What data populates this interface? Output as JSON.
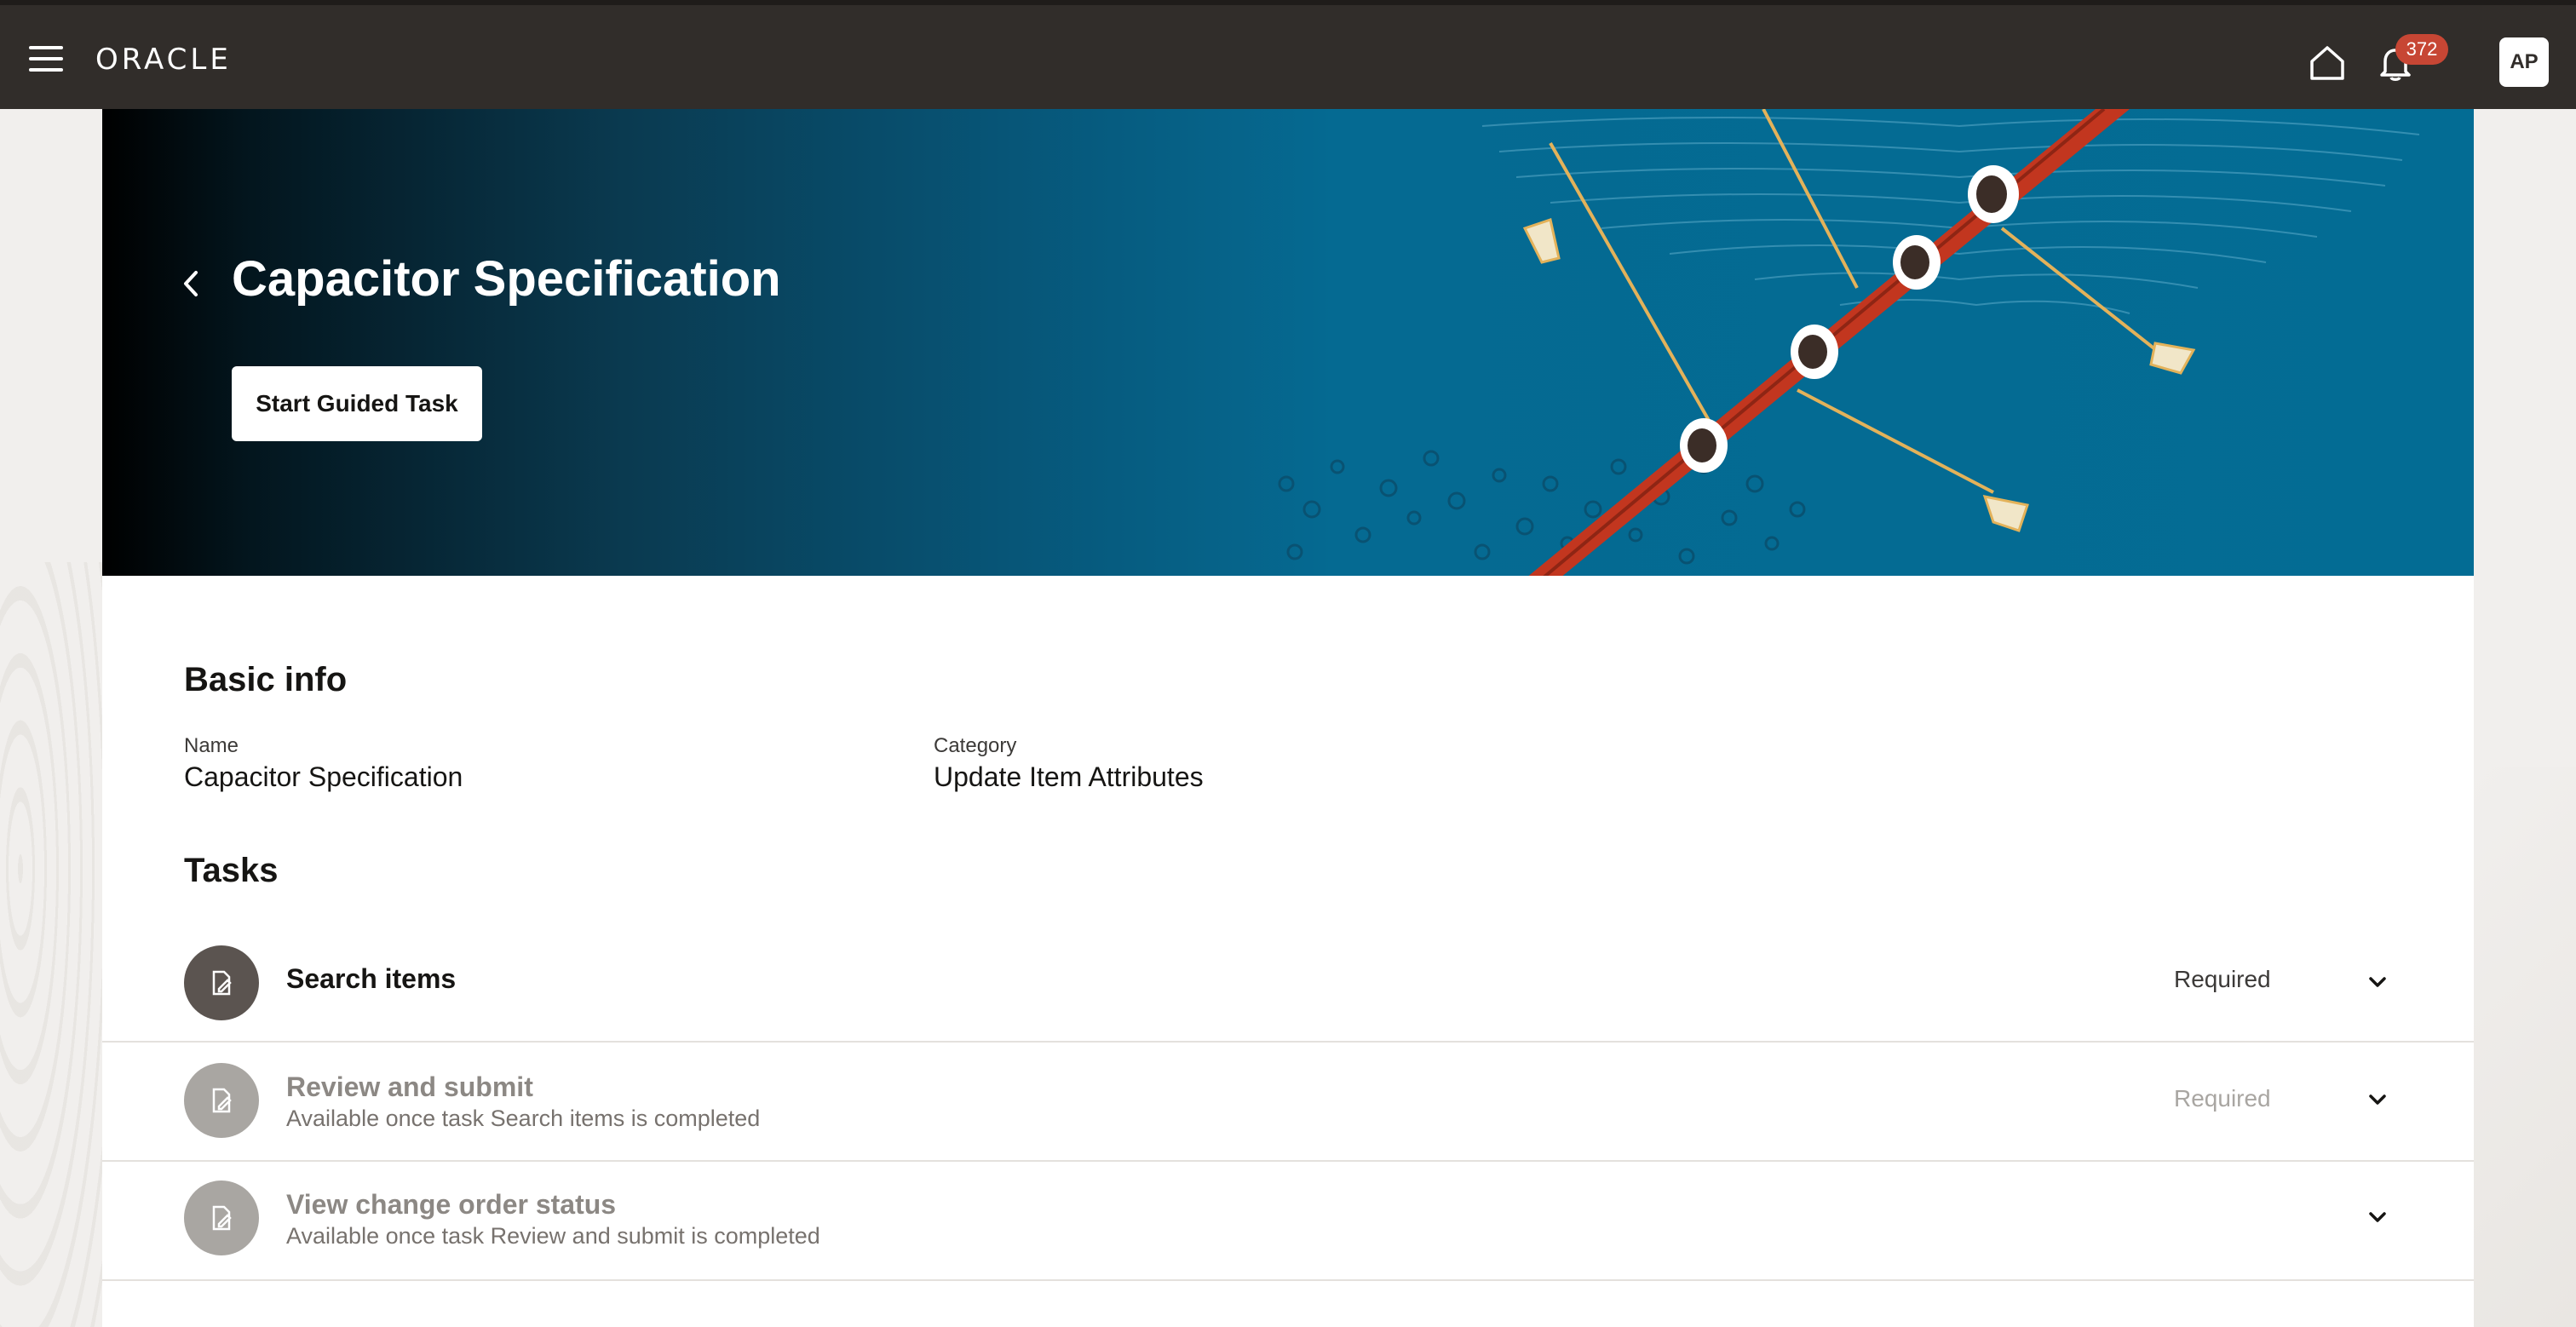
{
  "header": {
    "logo": "ORACLE",
    "notifications_count": "372",
    "avatar_initials": "AP"
  },
  "hero": {
    "title": "Capacitor Specification",
    "start_button": "Start Guided Task"
  },
  "basic_info": {
    "heading": "Basic info",
    "name_label": "Name",
    "name_value": "Capacitor Specification",
    "category_label": "Category",
    "category_value": "Update Item Attributes"
  },
  "tasks": {
    "heading": "Tasks",
    "items": [
      {
        "title": "Search items",
        "subtitle": "",
        "status": "Required"
      },
      {
        "title": "Review and submit",
        "subtitle": "Available once task Search items is completed",
        "status": "Required"
      },
      {
        "title": "View change order status",
        "subtitle": "Available once task Review and submit is completed",
        "status": ""
      }
    ]
  },
  "colors": {
    "header_bg": "#312d2a",
    "badge": "#c74634",
    "hero_blue": "#036c94",
    "boat_red": "#c2361f"
  }
}
